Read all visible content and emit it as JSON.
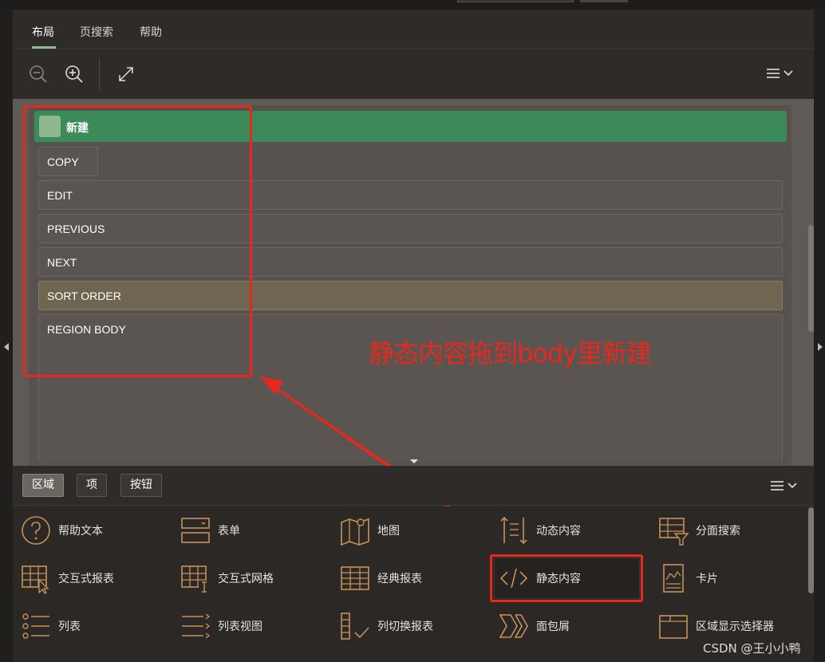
{
  "tabs": [
    {
      "label": "布局",
      "active": true
    },
    {
      "label": "页搜索",
      "active": false
    },
    {
      "label": "帮助",
      "active": false
    }
  ],
  "toolbar": {
    "icons": [
      "zoom-out-icon",
      "zoom-in-icon",
      "expand-icon",
      "list-menu-icon"
    ]
  },
  "layout": {
    "header_label": "新建",
    "slots": [
      {
        "label": "COPY"
      },
      {
        "label": "EDIT"
      },
      {
        "label": "PREVIOUS"
      },
      {
        "label": "NEXT"
      },
      {
        "label": "SORT ORDER",
        "highlighted": true
      },
      {
        "label": "REGION BODY"
      }
    ]
  },
  "annotation": {
    "text": "静态内容拖到body里新建",
    "color": "#e8281f"
  },
  "palette": {
    "buttons": [
      {
        "label": "区域",
        "active": true
      },
      {
        "label": "项",
        "active": false
      },
      {
        "label": "按钮",
        "active": false
      }
    ],
    "items": [
      {
        "label": "帮助文本",
        "icon": "help-icon"
      },
      {
        "label": "表单",
        "icon": "form-icon"
      },
      {
        "label": "地图",
        "icon": "map-icon"
      },
      {
        "label": "动态内容",
        "icon": "dynamic-content-icon"
      },
      {
        "label": "分面搜索",
        "icon": "faceted-search-icon"
      },
      {
        "label": "交互式报表",
        "icon": "interactive-report-icon"
      },
      {
        "label": "交互式网格",
        "icon": "interactive-grid-icon"
      },
      {
        "label": "经典报表",
        "icon": "classic-report-icon"
      },
      {
        "label": "静态内容",
        "icon": "static-content-icon",
        "selected": true
      },
      {
        "label": "卡片",
        "icon": "cards-icon"
      },
      {
        "label": "列表",
        "icon": "list-icon"
      },
      {
        "label": "列表视图",
        "icon": "list-view-icon"
      },
      {
        "label": "列切换报表",
        "icon": "column-toggle-report-icon"
      },
      {
        "label": "面包屑",
        "icon": "breadcrumb-icon"
      },
      {
        "label": "区域显示选择器",
        "icon": "region-display-selector-icon"
      }
    ]
  },
  "watermark": "CSDN @王小小鸭",
  "colors": {
    "accent_green": "#3c8a5a",
    "icon_orange": "#c8915a",
    "highlight_red": "#e8281f"
  }
}
